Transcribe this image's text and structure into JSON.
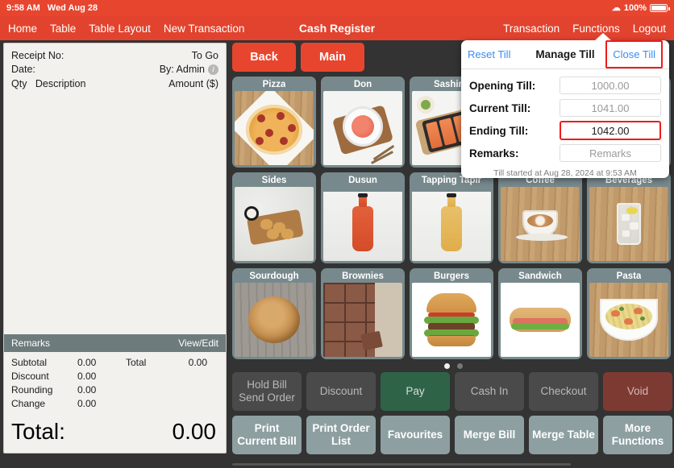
{
  "statusbar": {
    "time": "9:58 AM",
    "date": "Wed Aug 28",
    "battery": "100%",
    "wifi_icon": "wifi-icon"
  },
  "navbar": {
    "title": "Cash Register",
    "left_items": [
      {
        "label": "Home"
      },
      {
        "label": "Table"
      },
      {
        "label": "Table Layout"
      },
      {
        "label": "New Transaction"
      }
    ],
    "right_items": [
      {
        "label": "Transaction"
      },
      {
        "label": "Functions"
      },
      {
        "label": "Logout"
      }
    ]
  },
  "receipt": {
    "receipt_no_label": "Receipt No:",
    "receipt_no_value": "",
    "order_type": "To Go",
    "date_label": "Date:",
    "date_value": "",
    "by_label": "By: Admin",
    "info_icon": "info-circle-icon",
    "col_qty": "Qty",
    "col_description": "Description",
    "col_amount": "Amount ($)",
    "remarks_label": "Remarks",
    "view_edit_label": "View/Edit",
    "totals": [
      {
        "label": "Subtotal",
        "value": "0.00"
      },
      {
        "label": "Discount",
        "value": "0.00"
      },
      {
        "label": "Rounding",
        "value": "0.00"
      },
      {
        "label": "Change",
        "value": "0.00"
      }
    ],
    "total_side_label": "Total",
    "total_side_value": "0.00",
    "grand_label": "Total:",
    "grand_value": "0.00"
  },
  "top_buttons": [
    {
      "label": "Back"
    },
    {
      "label": "Main"
    }
  ],
  "search_icon": "search-icon",
  "category_grid": {
    "rows": [
      [
        {
          "label": "Pizza",
          "image": "pizza-photo"
        },
        {
          "label": "Don",
          "image": "rice-bowl-photo"
        },
        {
          "label": "Sashimi",
          "image": "sashimi-photo"
        },
        {
          "label": "",
          "image": "hidden-photo"
        },
        {
          "label": "",
          "image": "hidden-photo"
        }
      ],
      [
        {
          "label": "Sides",
          "image": "fried-sides-photo"
        },
        {
          "label": "Dusun",
          "image": "red-bottle-photo"
        },
        {
          "label": "Tapping Tapir",
          "image": "amber-bottle-photo"
        },
        {
          "label": "Coffee",
          "image": "latte-photo"
        },
        {
          "label": "Beverages",
          "image": "iced-drink-photo"
        }
      ],
      [
        {
          "label": "Sourdough",
          "image": "sourdough-photo"
        },
        {
          "label": "Brownies",
          "image": "brownies-photo"
        },
        {
          "label": "Burgers",
          "image": "burger-photo"
        },
        {
          "label": "Sandwich",
          "image": "sandwich-photo"
        },
        {
          "label": "Pasta",
          "image": "pasta-photo"
        }
      ]
    ],
    "page_dots": {
      "count": 2,
      "active_index": 0
    }
  },
  "action_buttons": {
    "row1": [
      {
        "label": "Hold Bill\nSend Order",
        "style": "dark"
      },
      {
        "label": "Discount",
        "style": "dark"
      },
      {
        "label": "Pay",
        "style": "green"
      },
      {
        "label": "Cash In",
        "style": "dark"
      },
      {
        "label": "Checkout",
        "style": "dark"
      },
      {
        "label": "Void",
        "style": "red"
      }
    ],
    "row2": [
      {
        "label": "Print\nCurrent Bill",
        "style": "teal"
      },
      {
        "label": "Print Order\nList",
        "style": "teal"
      },
      {
        "label": "Favourites",
        "style": "teal"
      },
      {
        "label": "Merge Bill",
        "style": "teal"
      },
      {
        "label": "Merge Table",
        "style": "teal"
      },
      {
        "label": "More\nFunctions",
        "style": "teal"
      }
    ]
  },
  "popup": {
    "reset_label": "Reset Till",
    "title": "Manage Till",
    "close_label": "Close Till",
    "fields": [
      {
        "label": "Opening Till:",
        "value": "1000.00",
        "highlighted": false
      },
      {
        "label": "Current Till:",
        "value": "1041.00",
        "highlighted": false
      },
      {
        "label": "Ending Till:",
        "value": "1042.00",
        "highlighted": true
      }
    ],
    "remarks_label": "Remarks:",
    "remarks_placeholder": "Remarks",
    "footer": "Till started at Aug 28, 2024 at 9:53 AM"
  },
  "colors": {
    "brand_red": "#e2432e",
    "status_red": "#e8452f",
    "tile_teal": "#77898c",
    "pay_green": "#2f6348",
    "void_red": "#7d3a33",
    "link_blue": "#3b8cf0",
    "highlight_red": "#ee1c1c"
  }
}
